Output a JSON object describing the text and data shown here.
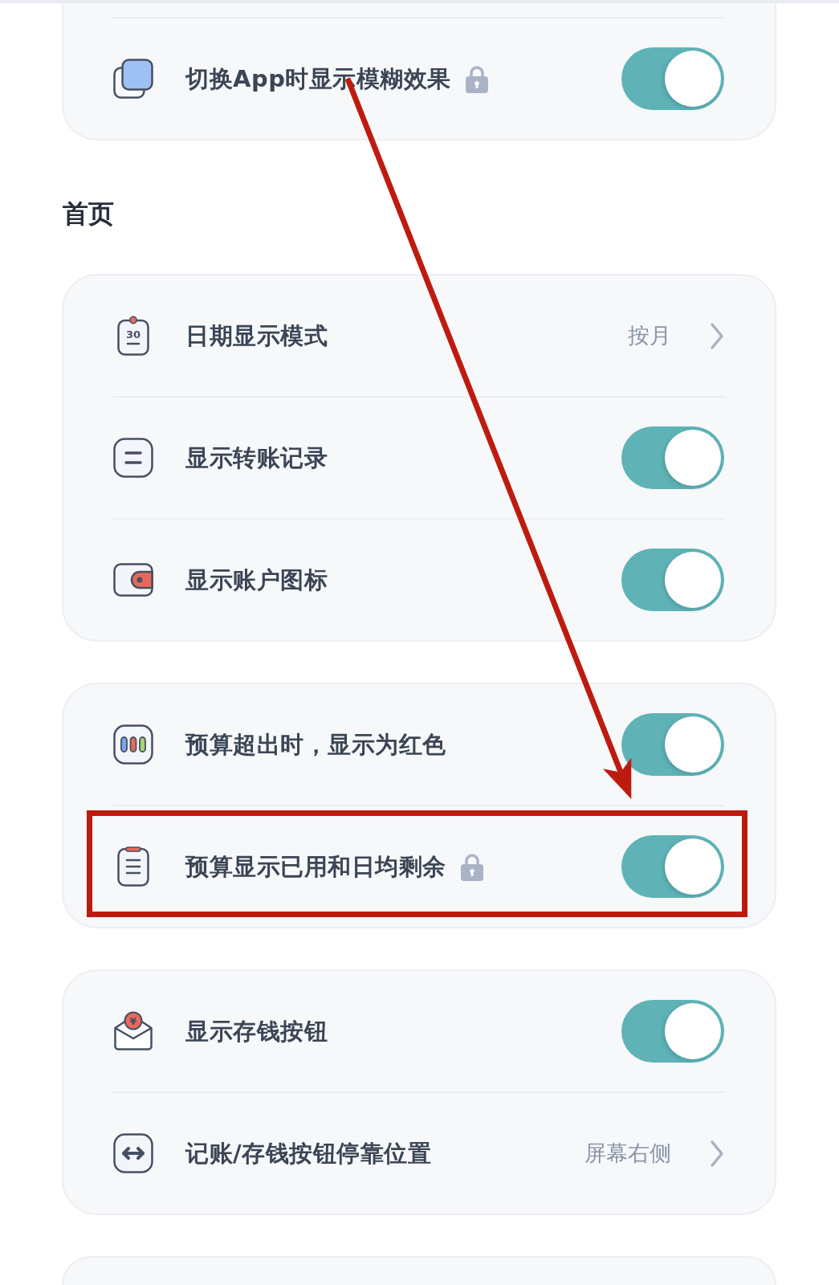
{
  "sections": [
    {
      "cards": [
        {
          "clipped": true,
          "rows": [
            {
              "kind": "toggle",
              "label": "切换App时显示模糊效果",
              "locked": true,
              "on": true,
              "highlighted": false,
              "arrow_start": true
            }
          ]
        }
      ]
    },
    {
      "title": "首页",
      "cards": [
        {
          "clipped": false,
          "rows": [
            {
              "kind": "link",
              "label": "日期显示模式",
              "icon_label": "30",
              "locked": false,
              "value": "按月",
              "highlighted": false,
              "arrow_start": false
            },
            {
              "kind": "toggle",
              "label": "显示转账记录",
              "locked": false,
              "on": true,
              "highlighted": false,
              "arrow_start": false
            },
            {
              "kind": "toggle",
              "label": "显示账户图标",
              "locked": false,
              "on": true,
              "highlighted": false,
              "arrow_start": false
            }
          ]
        },
        {
          "clipped": false,
          "rows": [
            {
              "kind": "toggle",
              "label": "预算超出时，显示为红色",
              "locked": false,
              "on": true,
              "highlighted": false,
              "arrow_start": false
            },
            {
              "kind": "toggle",
              "label": "预算显示已用和日均剩余",
              "locked": true,
              "on": true,
              "highlighted": true,
              "arrow_start": false
            }
          ]
        },
        {
          "clipped": false,
          "rows": [
            {
              "kind": "toggle",
              "label": "显示存钱按钮",
              "icon_label": "¥",
              "locked": false,
              "on": true,
              "highlighted": false,
              "arrow_start": false
            },
            {
              "kind": "link",
              "label": "记账/存钱按钮停靠位置",
              "locked": false,
              "value": "屏幕右侧",
              "highlighted": false,
              "arrow_start": false
            }
          ]
        },
        {
          "clipped": true
        }
      ]
    }
  ]
}
